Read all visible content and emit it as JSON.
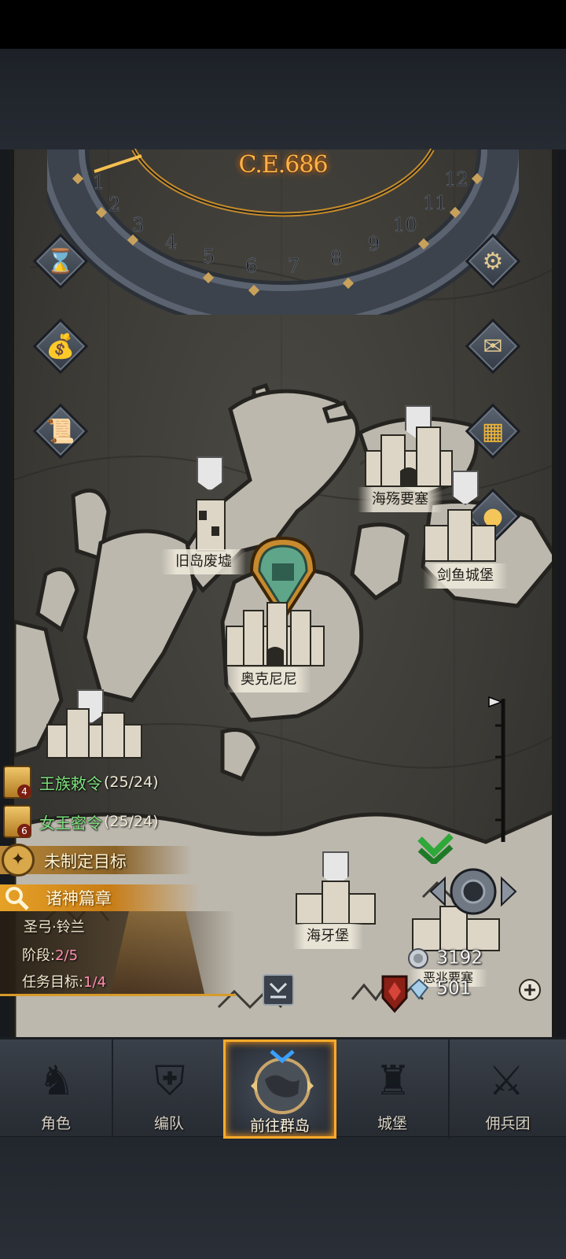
{
  "calendar": {
    "year_label": "C.E.686",
    "months": [
      "1",
      "2",
      "3",
      "4",
      "5",
      "6",
      "7",
      "8",
      "9",
      "10",
      "11",
      "12"
    ]
  },
  "side_buttons": {
    "left": [
      "hourglass-icon",
      "money-bag-icon",
      "scroll-map-icon"
    ],
    "right": [
      "gear-icon",
      "mail-icon",
      "calendar-grid-icon",
      "coin-icon"
    ]
  },
  "locations": [
    {
      "name": "海殇要塞"
    },
    {
      "name": "旧岛废墟"
    },
    {
      "name": "剑鱼城堡"
    },
    {
      "name": "奥克尼尼"
    },
    {
      "name": "海牙堡"
    },
    {
      "name": "恶兆要塞"
    }
  ],
  "orders": [
    {
      "name": "王族敕令",
      "count": "(25/24)",
      "badge": "4"
    },
    {
      "name": "女王密令",
      "count": "(25/24)",
      "badge": "6"
    }
  ],
  "goal": {
    "label": "未制定目标"
  },
  "chapter": {
    "title": "诸神篇章",
    "hero_name": "圣弓·铃兰",
    "stage_label": "阶段:",
    "stage_value": "2/5",
    "objective_label": "任务目标:",
    "objective_value": "1/4"
  },
  "resources": {
    "silver": "3192",
    "crystal": "501"
  },
  "nav": [
    {
      "label": "角色",
      "icon": "knight-icon"
    },
    {
      "label": "编队",
      "icon": "helmet-icon"
    },
    {
      "label": "前往群岛",
      "icon": "globe-icon"
    },
    {
      "label": "城堡",
      "icon": "castle-icon"
    },
    {
      "label": "佣兵团",
      "icon": "banner-icon"
    }
  ],
  "colors": {
    "accent": "#ffab2a",
    "year": "#ffb347",
    "order_text": "#7de07d",
    "progress_pink": "#ff8fb0"
  }
}
